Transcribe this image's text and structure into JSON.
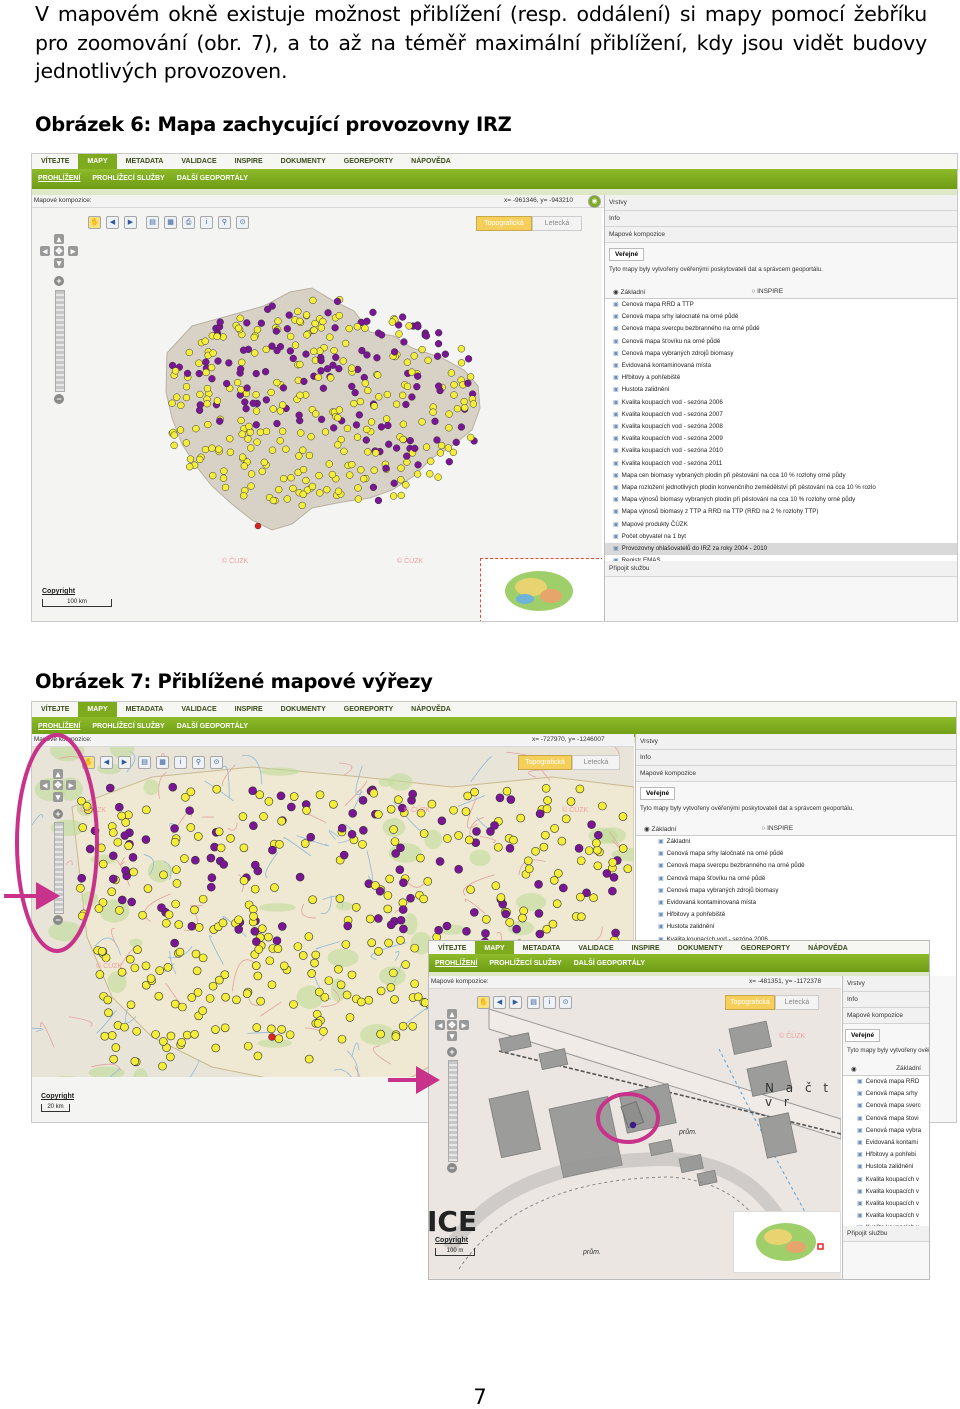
{
  "paragraph": "V mapovém okně existuje možnost přiblížení (resp. oddálení) si mapy pomocí žebříku pro zoomování (obr. 7), a to až na téměř maximální přiblížení, kdy jsou vidět budovy jednotlivých provozoven.",
  "caption1": "Obrázek 6: Mapa zachycující provozovny IRZ",
  "caption2": "Obrázek 7: Přiblížené mapové výřezy",
  "page_number": "7",
  "nav_main": [
    "VÍTEJTE",
    "MAPY",
    "METADATA",
    "VALIDACE",
    "INSPIRE",
    "DOKUMENTY",
    "GEOREPORTY",
    "NÁPOVĚDA"
  ],
  "nav_sub": [
    "PROHLÍŽENÍ",
    "PROHLÍŽECÍ SLUŽBY",
    "DALŠÍ GEOPORTÁLY"
  ],
  "map_compositions_label": "Mapové kompozice:",
  "shot1": {
    "coords": "x= -961346, y= -943210",
    "copyright": "Copyright",
    "scale": "100 km"
  },
  "shot2": {
    "coords": "x= -727970, y= -1246007",
    "copyright": "Copyright",
    "scale": "20 km"
  },
  "shot3": {
    "coords": "x= -481351, y= -1172378",
    "copyright": "Copyright",
    "scale": "100 m",
    "labels": [
      "N a  č t v r",
      "prům.",
      "prům.",
      "ICE"
    ]
  },
  "watermark": "© ČÚZK",
  "base_maps": [
    "Topografická",
    "Letecká"
  ],
  "side_panel": {
    "rows": [
      "Vrstvy",
      "Info",
      "Mapové kompozice"
    ],
    "tab": "Veřejné",
    "note": "Tyto mapy byly vytvořeny ověřenými poskytovateli dat a správcem geoportálu.",
    "radio_a": "Základní",
    "radio_b": "INSPIRE",
    "footer": "Připojit službu"
  },
  "layers_full": [
    "Cenová mapa RRD a TTP",
    "Cenová mapa srhy lalocnaté na orné půdě",
    "Cenová mapa svercpu bezbranného na orné půdě",
    "Cenová mapa šťovíku na orné půdě",
    "Cenová mapa vybraných zdrojů biomasy",
    "Evidovaná kontaminovaná místa",
    "Hřbitovy a pohřebiště",
    "Hustota zalidnění",
    "Kvalita koupacích vod - sezóna 2006",
    "Kvalita koupacích vod - sezóna 2007",
    "Kvalita koupacích vod - sezóna 2008",
    "Kvalita koupacích vod - sezóna 2009",
    "Kvalita koupacích vod - sezóna 2010",
    "Kvalita koupacích vod - sezóna 2011",
    "Mapa cen biomasy vybraných plodin při pěstování na cca 10 % rozlohy orné půdy",
    "Mapa rozložení jednotlivých plodin konvenčního zemědělství při pěstování na cca 10 % rozlo",
    "Mapa výnosů biomasy vybraných plodin při pěstování na cca 10 % rozlohy orné půdy",
    "Mapa výnosů biomasy z TTP a RRD na TTP (RRD na 2 % rozlohy TTP)",
    "Mapové produkty ČÚZK",
    "Počet obyvatel na 1 byt",
    "Provozovny ohlašovatelů do IRZ za roky 2004 - 2010",
    "Registr EMAS"
  ],
  "layers_short2": [
    "Základní",
    "Cenová mapa srhy laločnaté na orné půdě",
    "Cenová mapa svercpu bezbranného na orné půdě",
    "Cenová mapa šťovíku na orné půdě",
    "Cenová mapa vybraných zdrojů biomasy",
    "Evidovaná kontaminovaná místa",
    "Hřbitovy a pohřebiště",
    "Hustota zalidnění",
    "Kvalita koupacích vod - sezóna 2006"
  ],
  "layers_short3": [
    "Cenová mapa RRD",
    "Cenová mapa srhy",
    "Cenová mapa sverc",
    "Cenová mapa štovi",
    "Cenová mapa vybra",
    "Evidovaná kontami",
    "Hřbitovy a pohřebi",
    "Hustota zalidnění",
    "Kvalita koupacích v",
    "Kvalita koupacích v",
    "Kvalita koupacích v",
    "Kvalita koupacích v",
    "Kvalita koupacích v"
  ],
  "colors": {
    "nav_green": "#7eaa1e",
    "dot_yellow": "#f4ee3a",
    "dot_purple": "#7a1596",
    "highlight_magenta": "#c8328a"
  }
}
